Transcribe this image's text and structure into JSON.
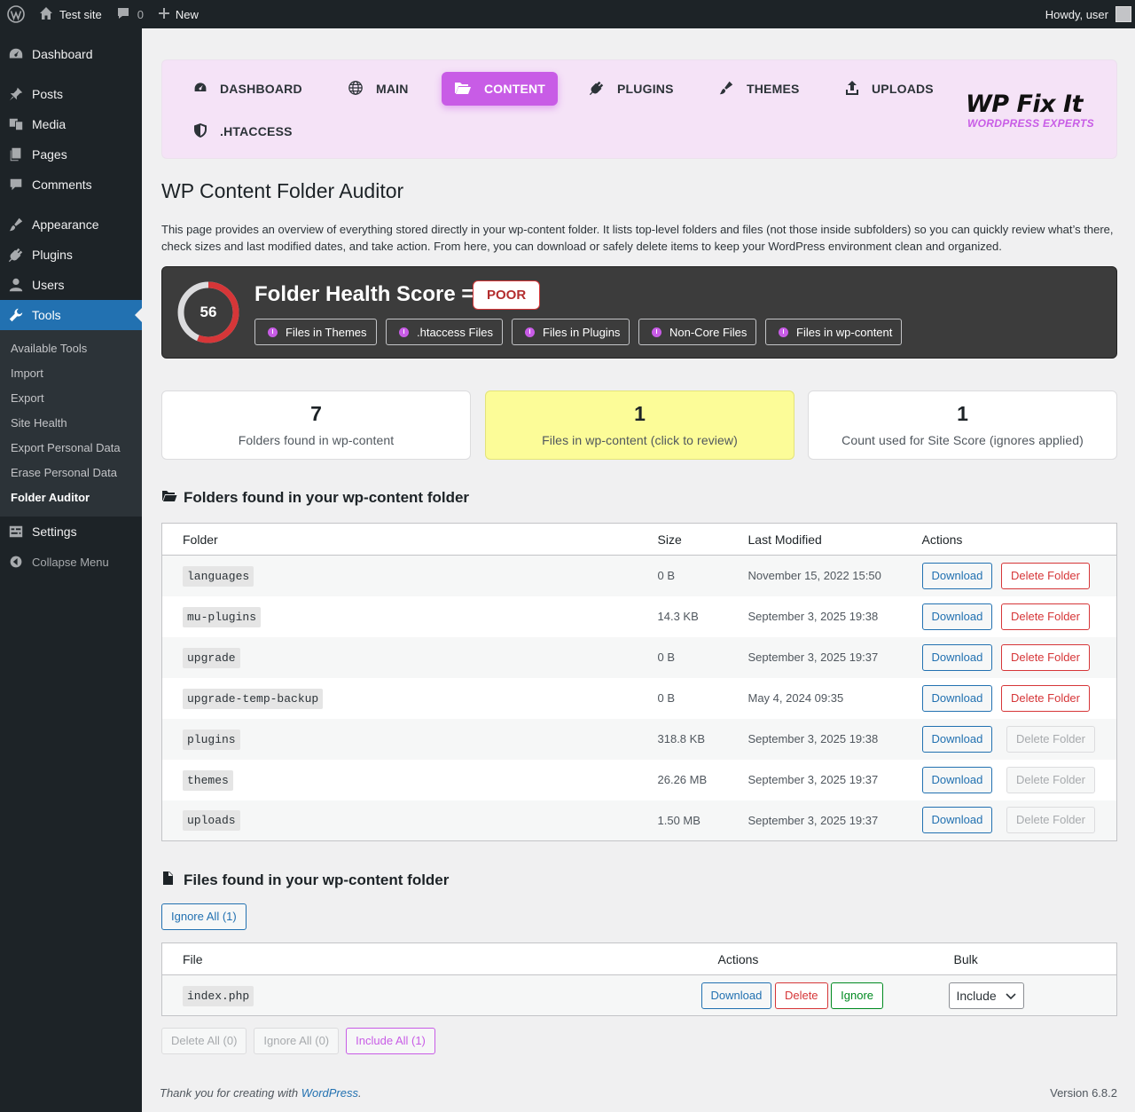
{
  "admin_bar": {
    "site_name": "Test site",
    "comments_count": "0",
    "new_label": "New",
    "greeting": "Howdy, user"
  },
  "sidebar": {
    "items": [
      {
        "label": "Dashboard",
        "icon": "dashboard-icon"
      },
      {
        "label": "Posts",
        "icon": "pin-icon"
      },
      {
        "label": "Media",
        "icon": "media-icon"
      },
      {
        "label": "Pages",
        "icon": "pages-icon"
      },
      {
        "label": "Comments",
        "icon": "comment-icon"
      },
      {
        "label": "Appearance",
        "icon": "brush-icon"
      },
      {
        "label": "Plugins",
        "icon": "plug-icon"
      },
      {
        "label": "Users",
        "icon": "user-icon"
      },
      {
        "label": "Tools",
        "icon": "wrench-icon"
      },
      {
        "label": "Settings",
        "icon": "settings-icon"
      }
    ],
    "tools_submenu": [
      "Available Tools",
      "Import",
      "Export",
      "Site Health",
      "Export Personal Data",
      "Erase Personal Data",
      "Folder Auditor"
    ],
    "collapse_label": "Collapse Menu"
  },
  "plugin_nav": {
    "tabs": [
      "DASHBOARD",
      "MAIN",
      "CONTENT",
      "PLUGINS",
      "THEMES",
      "UPLOADS",
      ".HTACCESS"
    ],
    "active": "CONTENT",
    "accent_color": "#c85ce6",
    "logo_line1": "WP Fix It",
    "logo_line2": "WORDPRESS EXPERTS"
  },
  "page": {
    "title": "WP Content Folder Auditor",
    "intro": "This page provides an overview of everything stored directly in your wp-content folder. It lists top-level folders and files (not those inside subfolders) so you can quickly review what’s there, check sizes and last modified dates, and take action. From here, you can download or safely delete items to keep your WordPress environment clean and organized."
  },
  "health": {
    "score": 56,
    "title": "Folder Health Score =",
    "grade": "POOR",
    "issues": [
      "Files in Themes",
      ".htaccess Files",
      "Files in Plugins",
      "Non-Core Files",
      "Files in wp-content"
    ]
  },
  "stats": [
    {
      "value": "7",
      "label": "Folders found in wp-content"
    },
    {
      "value": "1",
      "label": "Files in wp-content (click to review)"
    },
    {
      "value": "1",
      "label": "Count used for Site Score (ignores applied)"
    }
  ],
  "folders_section": {
    "title": "Folders found in your wp-content folder",
    "columns": [
      "Folder",
      "Size",
      "Last Modified",
      "Actions"
    ],
    "rows": [
      {
        "name": "languages",
        "size": "0 B",
        "modified": "November 15, 2022 15:50",
        "deletable": true
      },
      {
        "name": "mu-plugins",
        "size": "14.3 KB",
        "modified": "September 3, 2025 19:38",
        "deletable": true
      },
      {
        "name": "upgrade",
        "size": "0 B",
        "modified": "September 3, 2025 19:37",
        "deletable": true
      },
      {
        "name": "upgrade-temp-backup",
        "size": "0 B",
        "modified": "May 4, 2024 09:35",
        "deletable": true
      },
      {
        "name": "plugins",
        "size": "318.8 KB",
        "modified": "September 3, 2025 19:38",
        "deletable": false
      },
      {
        "name": "themes",
        "size": "26.26 MB",
        "modified": "September 3, 2025 19:37",
        "deletable": false
      },
      {
        "name": "uploads",
        "size": "1.50 MB",
        "modified": "September 3, 2025 19:37",
        "deletable": false
      }
    ],
    "download_label": "Download",
    "delete_label": "Delete Folder"
  },
  "files_section": {
    "title": "Files found in your wp-content folder",
    "ignore_all_top": "Ignore All (1)",
    "columns": [
      "File",
      "Actions",
      "Bulk"
    ],
    "rows": [
      {
        "name": "index.php",
        "bulk_value": "Include"
      }
    ],
    "download_label": "Download",
    "delete_label": "Delete",
    "ignore_label": "Ignore",
    "bulk_buttons": [
      "Delete All (0)",
      "Ignore All (0)",
      "Include All (1)"
    ]
  },
  "footer": {
    "thanks_prefix": "Thank you for creating with",
    "wordpress_link": "WordPress",
    "thanks_suffix": ".",
    "version": "Version 6.8.2"
  }
}
